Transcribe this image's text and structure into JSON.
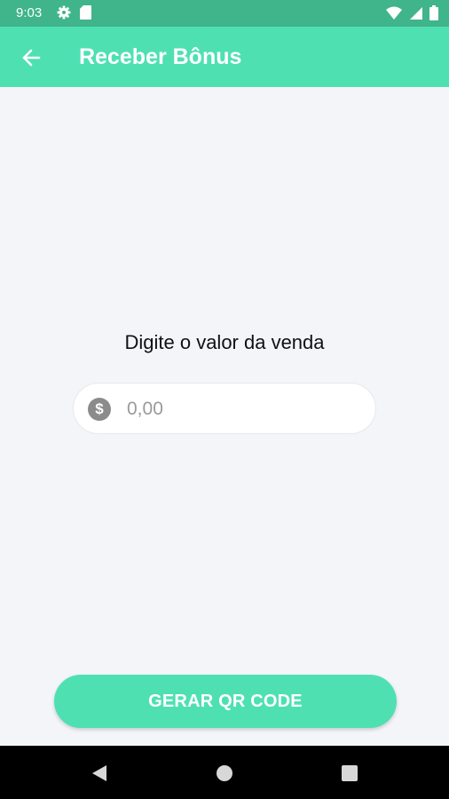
{
  "status_bar": {
    "time": "9:03",
    "left_icons": [
      "gear-icon",
      "sd-card-icon"
    ],
    "right_icons": [
      "wifi-icon",
      "signal-icon",
      "battery-icon"
    ]
  },
  "app_bar": {
    "title": "Receber Bônus",
    "back_icon": "arrow-left-icon",
    "color": "#4fe0b2"
  },
  "main": {
    "prompt": "Digite o valor da venda",
    "amount_field": {
      "placeholder": "0,00",
      "value": "",
      "icon": "dollar-icon"
    }
  },
  "cta": {
    "label": "GERAR QR CODE",
    "color": "#4fe0b2"
  },
  "nav_bar": {
    "buttons": [
      "back-triangle-icon",
      "home-circle-icon",
      "recents-square-icon"
    ]
  }
}
